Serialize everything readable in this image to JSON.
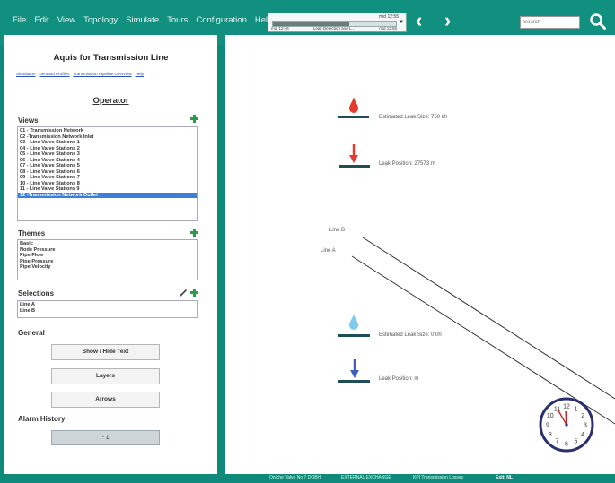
{
  "menu": [
    "File",
    "Edit",
    "View",
    "Topology",
    "Simulate",
    "Tours",
    "Configuration",
    "Help"
  ],
  "timebar": {
    "time_top": "mid 12:55",
    "progress": 0.62,
    "left_time": "mid 12:45",
    "center_label": "Leak Detection and L...",
    "right_time": "mid 12:55"
  },
  "nav": {
    "back": "‹",
    "forward": "›"
  },
  "search": {
    "placeholder": "Search"
  },
  "sidebar": {
    "title": "Aquis for Transmission Line",
    "links": [
      "Simulation",
      "Demand Profiles",
      "Transmission Pipeline Overview",
      "Help"
    ],
    "role": "Operator",
    "views_header": "Views",
    "views": [
      "01 - Transmission Network",
      "02 -Transmission Network Inlet",
      "03 - Line Valve Stations 1",
      "04 - Line Valve Stations 2",
      "05 - Line Valve Stations 3",
      "06 - Line Valve Stations 4",
      "07 - Line Valve Stations 5",
      "08 - Line Valve Stations 6",
      "09 - Line Valve Stations 7",
      "10 - Line Valve Stations 8",
      "11 - Line Valve Stations 9",
      "12 -Transmission Network Outlet"
    ],
    "views_selected_index": 11,
    "themes_header": "Themes",
    "themes": [
      "Basic",
      "Node Pressure",
      "Pipe Flow",
      "Pipe Pressure",
      "Pipe Velocity"
    ],
    "selections_header": "Selections",
    "selections": [
      "Line A",
      "Line B"
    ],
    "general_header": "General",
    "buttons": {
      "show_hide": "Show / Hide Text",
      "layers": "Layers",
      "arrows": "Arrows"
    },
    "alarm_header": "Alarm History",
    "alarm_value": "* 1"
  },
  "canvas": {
    "leak1_size": "Estimated Leak Size: 750 t/h",
    "leak1_position": "Leak Position: 27573 m",
    "line_b": "Line B",
    "line_a": "Line A",
    "leak2_size": "Estimated Leak Size: 0 t/h",
    "leak2_position": "Leak Position:  m",
    "clock_time": "11:55"
  },
  "status_bar": {
    "item1": "Oniche Valve No 7 DOBH",
    "item2": "EXTERNAL EXCHANGE",
    "item3": "KPI Transmission Losses",
    "item4": "Exit: NL"
  },
  "colors": {
    "teal": "#0f8a7a",
    "leak_red": "#e53b2c",
    "leak_blue": "#3e5fb8",
    "water_light": "#7fc8ee",
    "selection_blue": "#3d7fd6",
    "add_green": "#23a046"
  }
}
